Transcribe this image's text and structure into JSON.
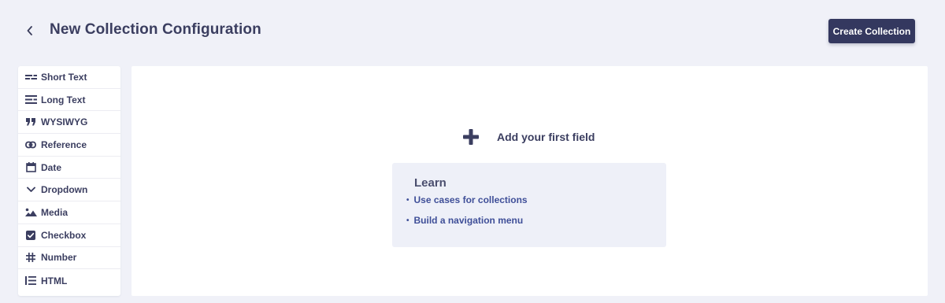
{
  "header": {
    "title": "New Collection Configuration",
    "create_button_label": "Create Collection"
  },
  "field_types": [
    {
      "label": "Short Text",
      "icon": "short-text-icon"
    },
    {
      "label": "Long Text",
      "icon": "long-text-icon"
    },
    {
      "label": "WYSIWYG",
      "icon": "quote-icon"
    },
    {
      "label": "Reference",
      "icon": "link-icon"
    },
    {
      "label": "Date",
      "icon": "calendar-icon"
    },
    {
      "label": "Dropdown",
      "icon": "chevron-down-icon"
    },
    {
      "label": "Media",
      "icon": "image-icon"
    },
    {
      "label": "Checkbox",
      "icon": "checkbox-icon"
    },
    {
      "label": "Number",
      "icon": "hash-icon"
    },
    {
      "label": "HTML",
      "icon": "list-icon"
    }
  ],
  "canvas": {
    "empty_label": "Add your first field",
    "learn": {
      "title": "Learn",
      "links": [
        "Use cases for collections",
        "Build a navigation menu"
      ]
    }
  },
  "colors": {
    "background": "#f0f1f8",
    "primary": "#34385f",
    "link": "#3f4f98"
  }
}
